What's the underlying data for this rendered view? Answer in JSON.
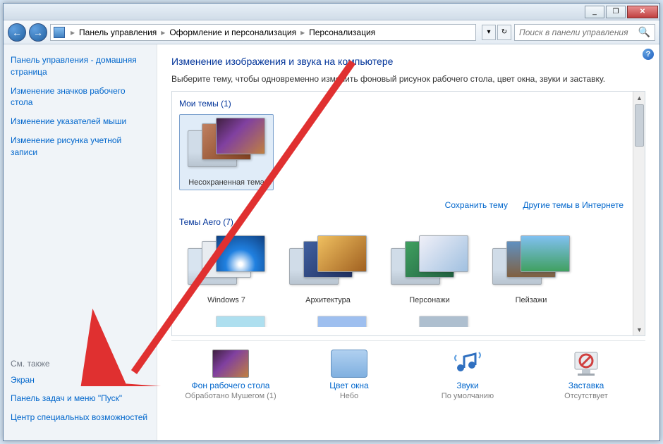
{
  "titlebar": {
    "minimize": "_",
    "maximize": "❐",
    "close": "✕"
  },
  "nav": {
    "back": "←",
    "forward": "→"
  },
  "breadcrumb": {
    "items": [
      "Панель управления",
      "Оформление и персонализация",
      "Персонализация"
    ]
  },
  "search": {
    "placeholder": "Поиск в панели управления"
  },
  "sidebar": {
    "links": [
      "Панель управления - домашняя страница",
      "Изменение значков рабочего стола",
      "Изменение указателей мыши",
      "Изменение рисунка учетной записи"
    ],
    "seealso_header": "См. также",
    "seealso": [
      "Экран",
      "Панель задач и меню \"Пуск\"",
      "Центр специальных возможностей"
    ]
  },
  "main": {
    "title": "Изменение изображения и звука на компьютере",
    "subtitle": "Выберите тему, чтобы одновременно изменить фоновый рисунок рабочего стола, цвет окна, звуки и заставку.",
    "my_themes_header": "Мои темы (1)",
    "my_themes": [
      {
        "label": "Несохраненная тема"
      }
    ],
    "save_link": "Сохранить тему",
    "online_link": "Другие темы в Интернете",
    "aero_header": "Темы Aero (7)",
    "aero_themes": [
      {
        "label": "Windows 7"
      },
      {
        "label": "Архитектура"
      },
      {
        "label": "Персонажи"
      },
      {
        "label": "Пейзажи"
      }
    ],
    "options": {
      "bg": {
        "label": "Фон рабочего стола",
        "sub": "Обработано Мушегом (1)"
      },
      "color": {
        "label": "Цвет окна",
        "sub": "Небо"
      },
      "sound": {
        "label": "Звуки",
        "sub": "По умолчанию"
      },
      "saver": {
        "label": "Заставка",
        "sub": "Отсутствует"
      }
    }
  }
}
